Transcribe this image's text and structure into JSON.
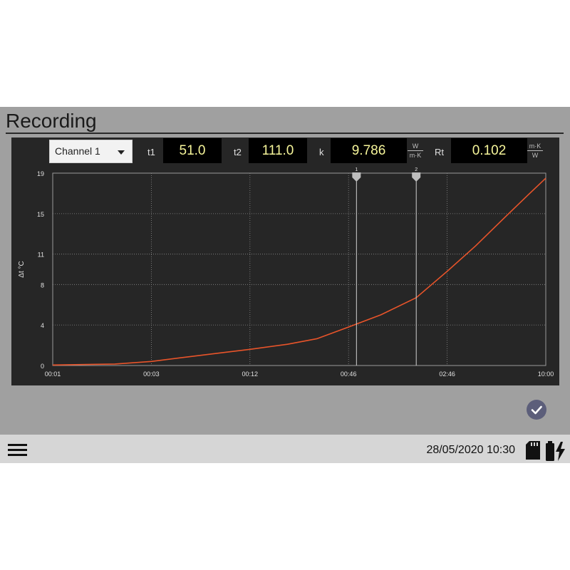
{
  "screen": {
    "title": "Recording"
  },
  "toolbar": {
    "channel_select": "Channel 1",
    "t1_label": "t1",
    "t1_value": "51.0",
    "t2_label": "t2",
    "t2_value": "111.0",
    "k_label": "k",
    "k_value": "9.786",
    "k_unit_num": "W",
    "k_unit_den": "m·K",
    "rt_label": "Rt",
    "rt_value": "0.102",
    "rt_unit_num": "m·K",
    "rt_unit_den": "W"
  },
  "chart_data": {
    "type": "line",
    "ylabel": "Δt °C",
    "y_ticks": [
      0,
      4,
      8,
      11,
      15,
      19
    ],
    "ylim": [
      0,
      19
    ],
    "x_ticks": [
      "00:01",
      "00:03",
      "00:12",
      "00:46",
      "02:46",
      "10:00"
    ],
    "x_scale": "log (time)",
    "grid": true,
    "colors": {
      "line": "#e8542a",
      "cursor": "#d0d0d0",
      "background": "#262626"
    },
    "cursors": [
      {
        "label": "1",
        "x": "00:51"
      },
      {
        "label": "2",
        "x": "01:51"
      }
    ],
    "series": [
      {
        "x": [
          "00:01",
          "00:02",
          "00:03",
          "00:05",
          "00:08",
          "00:12",
          "00:20",
          "00:30",
          "00:46",
          "01:10",
          "01:51",
          "02:46",
          "04:00",
          "06:00",
          "08:00",
          "10:00"
        ],
        "values": [
          0.05,
          0.15,
          0.4,
          0.85,
          1.25,
          1.6,
          2.1,
          2.65,
          3.8,
          5.0,
          6.7,
          9.3,
          11.8,
          14.8,
          16.9,
          18.5
        ]
      }
    ]
  },
  "actions": {
    "confirm_icon": "checkmark-icon"
  },
  "statusbar": {
    "datetime": "28/05/2020 10:30",
    "sd_icon": "sd-card-icon",
    "battery_icon": "battery-charging-icon"
  }
}
